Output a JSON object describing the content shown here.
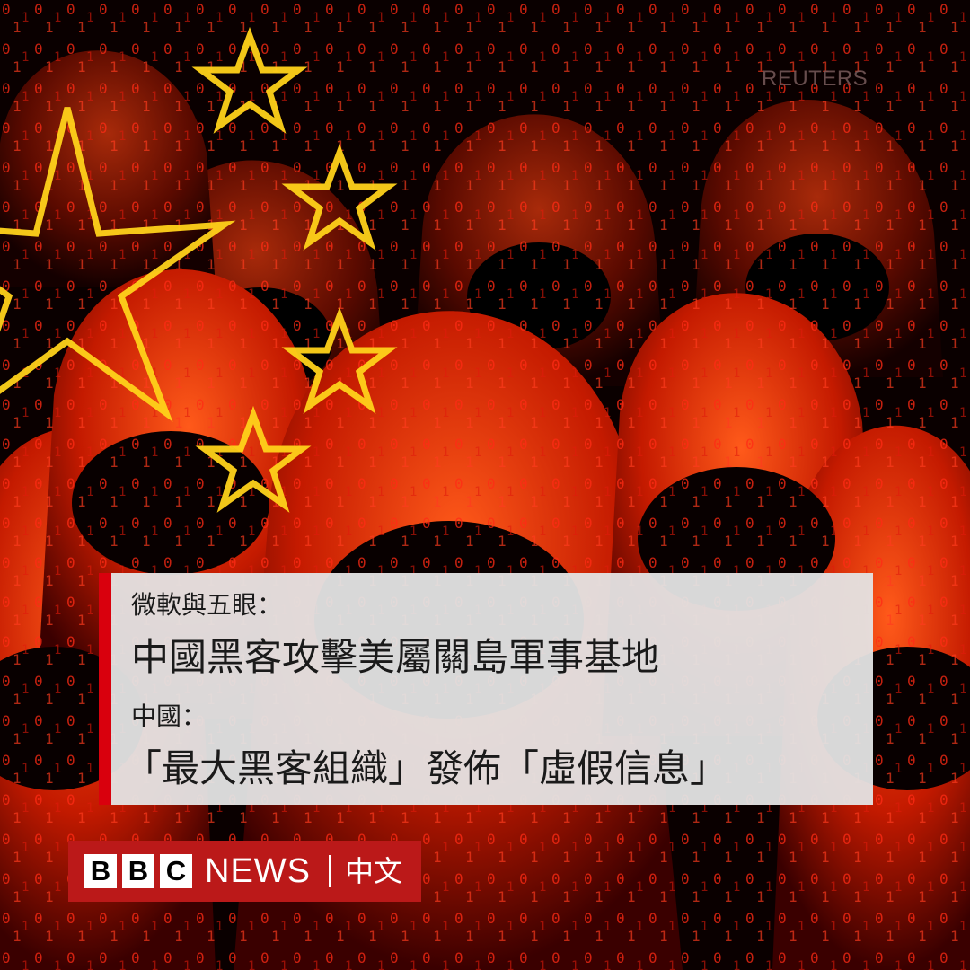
{
  "photo_credit": "REUTERS",
  "headline": {
    "line1": "微軟與五眼：",
    "line2": "中國黑客攻擊美屬關島軍事基地",
    "line3": "中國：",
    "line4": "「最大黑客組織」發佈「虛假信息」"
  },
  "logo": {
    "b1": "B",
    "b2": "B",
    "b3": "C",
    "news": "NEWS",
    "lang": "中文"
  },
  "colors": {
    "accent_red": "#d9000d",
    "logo_red": "#bb1919",
    "panel": "#e4e4e4"
  }
}
